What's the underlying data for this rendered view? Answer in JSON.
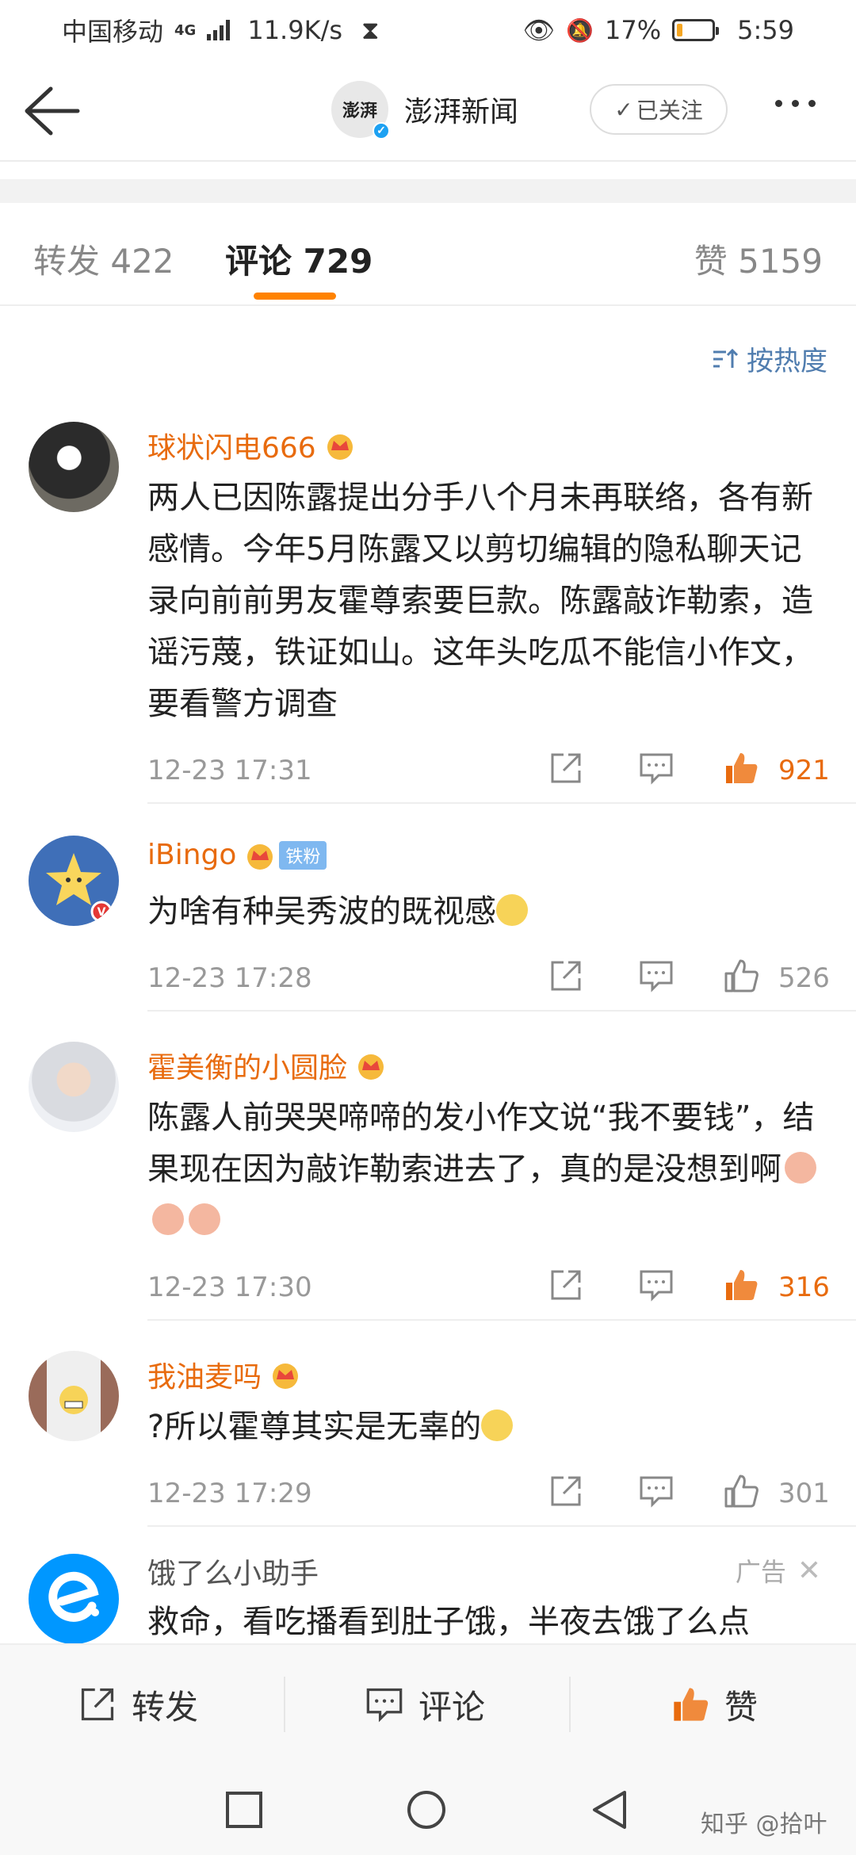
{
  "status_bar": {
    "carrier": "中国移动",
    "network": "4G",
    "speed": "11.9K/s",
    "battery_percent": "17%",
    "battery_level": 0.17,
    "time": "5:59"
  },
  "header": {
    "account_name": "澎湃新闻",
    "avatar_text": "澎湃",
    "follow_label": "已关注"
  },
  "tabs": [
    {
      "label": "转发 422"
    },
    {
      "label": "评论 729"
    },
    {
      "label": "赞 5159"
    }
  ],
  "sort_label": "按热度",
  "comments": [
    {
      "name": "球状闪电666",
      "text": "两人已因陈露提出分手八个月未再联络，各有新感情。今年5月陈露又以剪切编辑的隐私聊天记录向前前男友霍尊索要巨款。陈露敲诈勒索，造谣污蔑，铁证如山。这年头吃瓜不能信小作文，要看警方调查",
      "time": "12-23 17:31",
      "likes": "921",
      "liked": true
    },
    {
      "name": "iBingo",
      "badge": "铁粉",
      "text": "为啥有种吴秀波的既视感",
      "time": "12-23 17:28",
      "likes": "526",
      "liked": false
    },
    {
      "name": "霍美衡的小圆脸",
      "text": "陈露人前哭哭啼啼的发小作文说“我不要钱”，结果现在因为敲诈勒索进去了，真的是没想到啊",
      "time": "12-23 17:30",
      "likes": "316",
      "liked": true
    },
    {
      "name": "我油麦吗",
      "text": "?所以霍尊其实是无辜的",
      "time": "12-23 17:29",
      "likes": "301",
      "liked": false
    }
  ],
  "ad": {
    "name": "饿了么小助手",
    "label": "广告",
    "text": "救命，看吃播看到肚子饿，半夜去饿了么点"
  },
  "bottom_bar": {
    "repost": "转发",
    "comment": "评论",
    "like": "赞"
  },
  "watermark": "知乎 @拾叶",
  "colors": {
    "accent": "#ff8200",
    "username": "#e86b0e",
    "link": "#507daf"
  }
}
